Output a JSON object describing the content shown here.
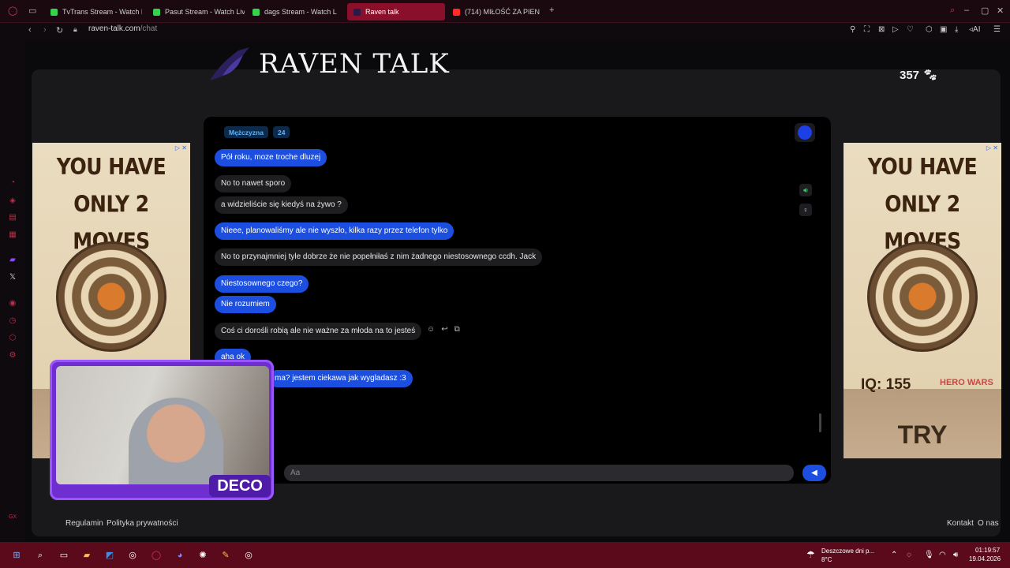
{
  "browser": {
    "tabs": [
      {
        "label": "TvTrans Stream - Watch L",
        "color": "#35d34a"
      },
      {
        "label": "Pasut Stream - Watch Live",
        "color": "#35d34a"
      },
      {
        "label": "dags Stream - Watch L",
        "color": "#35d34a"
      },
      {
        "label": "Raven talk",
        "color": "#8a0f2a"
      },
      {
        "label": "(714) MIŁOŚĆ ZA PIEN",
        "color": "#ff2a2a"
      }
    ],
    "url_host": "raven-talk.com",
    "url_path": "/chat",
    "ai_label": "AI"
  },
  "site": {
    "title": "RAVEN TALK",
    "online_count": "357"
  },
  "chat": {
    "partner_gender": "Mężczyzna",
    "partner_age": "24",
    "messages": [
      {
        "from": "me",
        "text": "Pół roku, moze troche dluzej"
      },
      {
        "from": "them",
        "text": "No to nawet sporo"
      },
      {
        "from": "them",
        "text": "a widzieliście się kiedyś na żywo ?"
      },
      {
        "from": "me",
        "text": "Nieee, planowaliśmy ale nie wyszło, kilka razy przez telefon tylko"
      },
      {
        "from": "them",
        "text": "No to przynajmniej tyle dobrze że nie popełniłaś z nim żadnego niestosownego ccdh. Jack"
      },
      {
        "from": "me",
        "text": "Niestosownego czego?"
      },
      {
        "from": "me",
        "text": "Nie rozumiem"
      },
      {
        "from": "them",
        "text": "Coś ci dorośli robią ale nie ważne za  młoda na to jesteś"
      },
      {
        "from": "me",
        "text": "aha ok"
      },
      {
        "from": "me",
        "text": "ma? jestem ciekawa jak wygladasz :3"
      }
    ],
    "input_placeholder": "Aa"
  },
  "ads": {
    "headline": "YOU HAVE ONLY 2 MOVES",
    "iq": "IQ: 155",
    "brand": "HERO WARS",
    "cta": "TRY"
  },
  "webcam": {
    "name": "DECO"
  },
  "footer": {
    "rules": "Regulamin",
    "privacy": "Polityka prywatności",
    "contact": "Kontakt",
    "about": "O nas"
  },
  "taskbar": {
    "weather": "Deszczowe dni p...",
    "temp": "8°C",
    "time": "01:19:57",
    "date": "19.04.2026"
  }
}
